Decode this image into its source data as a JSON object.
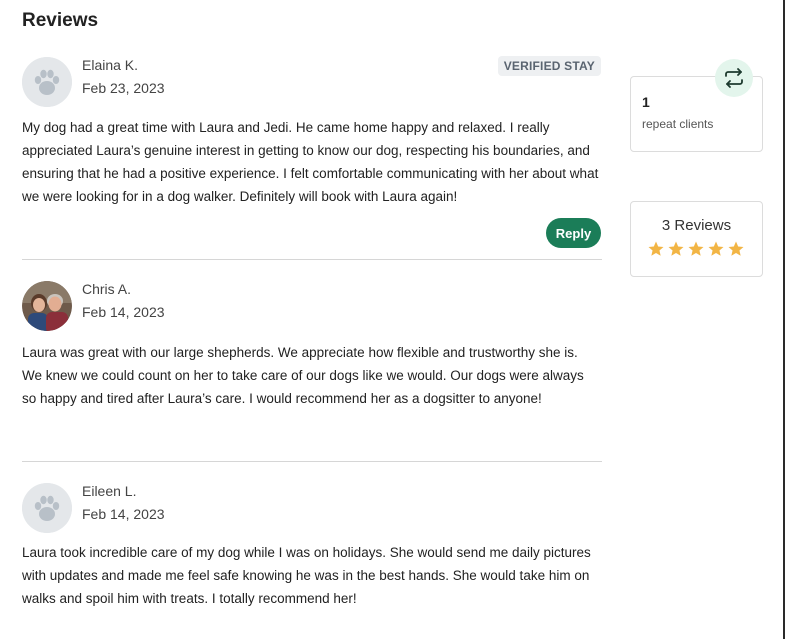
{
  "header": {
    "title": "Reviews"
  },
  "reviews": [
    {
      "name": "Elaina K.",
      "date": "Feb 23, 2023",
      "badge": "VERIFIED STAY",
      "avatar": "paw-icon",
      "text": "My dog had a great time with Laura and Jedi. He came home happy and relaxed. I really appreciated Laura’s genuine interest in getting to know our dog, respecting his boundaries, and ensuring that he had a positive experience. I felt comfortable communicating with her about what we were looking for in a dog walker. Definitely will book with Laura again!",
      "reply_label": "Reply"
    },
    {
      "name": "Chris A.",
      "date": "Feb 14, 2023",
      "avatar": "user-photo",
      "text": "Laura was great with our large shepherds. We appreciate how flexible and trustworthy she is. We knew we could count on her to take care of our dogs like we would. Our dogs were always so happy and tired after Laura’s care. I would recommend her as a dogsitter to anyone!"
    },
    {
      "name": "Eileen L.",
      "date": "Feb 14, 2023",
      "avatar": "paw-icon",
      "text": "Laura took incredible care of my dog while I was on holidays. She would send me daily pictures with updates and made me feel safe knowing he was in the best hands. She would take him on walks and spoil him with treats. I totally recommend her!"
    }
  ],
  "sidebar": {
    "repeat_clients": {
      "count": "1",
      "label": "repeat clients",
      "icon": "repeat-icon"
    },
    "reviews_summary": {
      "label": "3 Reviews",
      "rating": 5,
      "max_rating": 5,
      "star_color": "#f2b545"
    }
  },
  "colors": {
    "accent": "#1b7d58",
    "badge_bg": "#eef0f2",
    "repeat_icon_bg": "#e3f5ec"
  }
}
